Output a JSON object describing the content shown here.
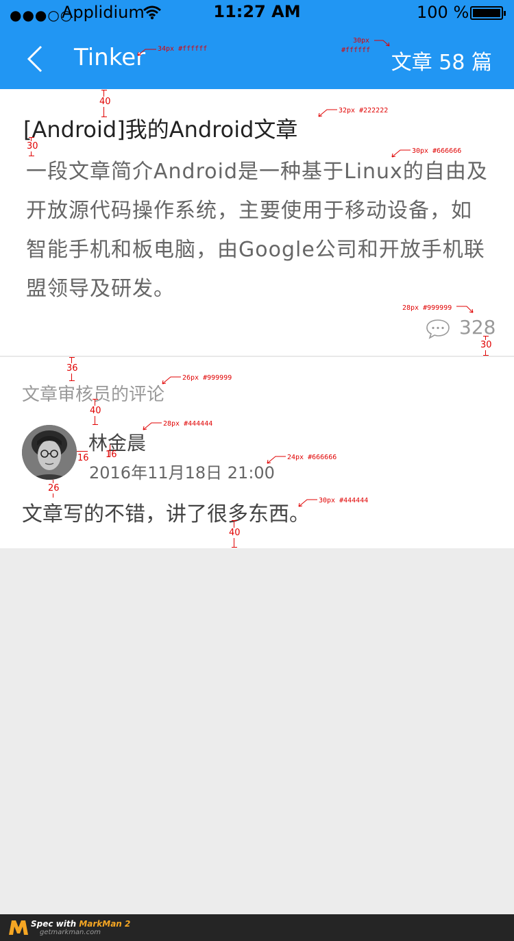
{
  "status_bar": {
    "signal": "●●●○○",
    "carrier": "Applidium",
    "time": "11:27 AM",
    "battery_percent": "100 %",
    "battery_level": 1.0
  },
  "nav": {
    "title": "Tinker",
    "article_count": "文章 58 篇"
  },
  "article": {
    "title": "[Android]我的Android文章",
    "description": "一段文章简介Android是一种基于Linux的自由及开放源代码操作系统，主要使用于移动设备，如智能手机和板电脑，由Google公司和开放手机联盟领导及研发。",
    "comment_count": "328"
  },
  "review": {
    "section_title": "文章审核员的评论",
    "reviewer_name": "林金晨",
    "date": "2016年11月18日 21:00",
    "comment": "文章写的不错，讲了很多东西。"
  },
  "annotations": {
    "nav_title_spec": "34px  #ffffff",
    "nav_count_size": "30px",
    "nav_count_color": "#ffffff",
    "title_spec": "32px  #222222",
    "desc_spec": "30px  #666666",
    "count_spec": "28px #999999",
    "section_spec": "26px #999999",
    "name_spec": "28px #444444",
    "date_spec": "24px #666666",
    "comment_spec": "30px #444444",
    "gap_40a": "40",
    "gap_30a": "30",
    "gap_30b": "30",
    "gap_36": "36",
    "gap_40b": "40",
    "gap_16a": "16",
    "gap_16b": "16",
    "gap_26": "26",
    "gap_40c": "40"
  },
  "footer": {
    "brand_prefix": "Spec with ",
    "brand_name": "MarkMan 2",
    "site": "getmarkman.com"
  },
  "colors": {
    "primary": "#2196f3",
    "page_bg": "#ececec",
    "annotation": "#e00000"
  }
}
